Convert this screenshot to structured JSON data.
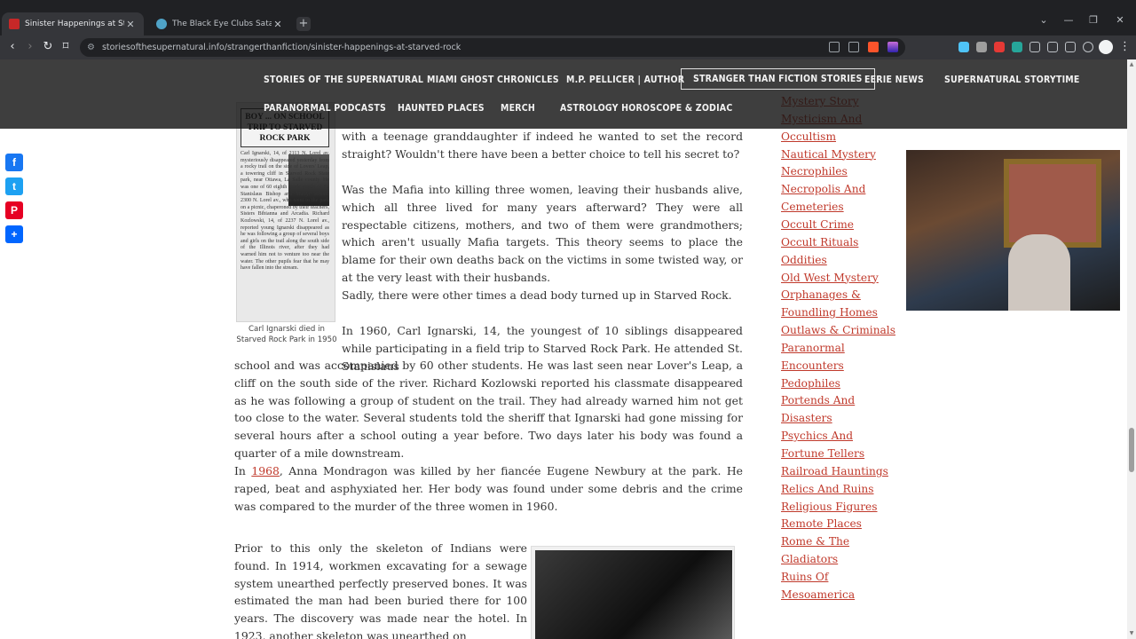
{
  "browser": {
    "tabs": [
      {
        "title": "Sinister Happenings at Starved R",
        "active": true,
        "favicon_color": "#c62828"
      },
      {
        "title": "The Black Eye Clubs Satanic Illuminat",
        "active": false,
        "favicon_color": "#4fa3c7"
      }
    ],
    "newtab_label": "+",
    "url": "storiesofthesupernatural.info/strangerthanfiction/sinister-happenings-at-starved-rock"
  },
  "nav": {
    "row1": [
      "STORIES OF THE SUPERNATURAL",
      "MIAMI GHOST CHRONICLES",
      "M.P. PELLICER | AUTHOR",
      "STRANGER THAN FICTION STORIES",
      "EERIE NEWS",
      "SUPERNATURAL STORYTIME"
    ],
    "row2": [
      "PARANORMAL PODCASTS",
      "HAUNTED PLACES",
      "MERCH",
      "ASTROLOGY HOROSCOPE & ZODIAC"
    ]
  },
  "share": [
    {
      "name": "Facebook",
      "glyph": "f",
      "color": "#1877f2"
    },
    {
      "name": "Twitter",
      "glyph": "t",
      "color": "#1da1f2"
    },
    {
      "name": "Pinterest",
      "glyph": "P",
      "color": "#e60023"
    },
    {
      "name": "Share",
      "glyph": "+",
      "color": "#0166ff"
    }
  ],
  "article": {
    "p_top": "with a teenage granddaughter if indeed he wanted to set the record straight? Wouldn't there have been a better choice to tell his secret to?",
    "p_mafia": "Was the Mafia into killing three women, leaving their husbands alive, which all three lived for many years afterward? They were all respectable citizens, mothers, and two of them were grandmothers; which aren't usually Mafia targets. This theory seems to place the blame for their own deaths back on the victims in some twisted way, or at the very least with their husbands.",
    "p_sadly": "Sadly, there were other times a dead body turned up in Starved Rock.",
    "p_1960_a": "In 1960, Carl Ignarski, 14, the youngest of 10 siblings disappeared while participating in a field trip to Starved Rock Park. He attended St. Stanislaus",
    "p_1960_b": "school and was accompanied by 60 other students. He was last seen near Lover's Leap, a cliff on the south side of the river. Richard Kozlowski reported his classmate disappeared as he was following a group of student on the trail. They had already warned him not get too close to the water. Several students told the sheriff that Ignarski had gone missing for several hours after a school outing a year before. Two days later his body was found a quarter of a mile downstream.",
    "p_1968_prefix": "In ",
    "p_1968_link": "1968",
    "p_1968_rest": ", Anna Mondragon was killed by her fiancée Eugene Newbury at the park. He raped, beat and asphyxiated her. Her body was found under some debris and the crime was compared to the murder of the three women in 1960.",
    "p_skeleton": "Prior to this only the skeleton of Indians were found.  In 1914, workmen excavating for a sewage system unearthed perfectly preserved bones. It was estimated the man had been buried there for 100 years. The discovery was made near the hotel. In 1923,  another skeleton was unearthed on",
    "figure_headline": "BOY ... ON SCHOOL TRIP TO STARVED ROCK PARK",
    "figure_text": "Carl Ignarski, 14, of 2113 N. Lorel av. mysteriously disappeared yesterday from a rocky trail on the side of Lovers' Leap, a towering cliff in Starved Rock State park, near Ottawa, La Salle county. He was one of 60 eighth grade pupils of St. Stanislaus Bishop and Martyr school, 2300 N. Lorel av., who went to the park on a picnic, chaperoned by their teachers, Sisters Bibianna and Arcadia. Richard Kozlowski, 14, of 2237 N. Lorel av., reported young Ignarski disappeared as he was following a group of several boys and girls on the trail along the south side of the Illinois river, after they had warned him not to venture too near the water. The other pupils fear that he may have fallen into the stream.",
    "figure_caption": "Carl Ignarski died in Starved Rock Park in 1950"
  },
  "categories": [
    "Mystery Story",
    "Mysticism And",
    "Occultism",
    "Nautical Mystery",
    "Necrophiles",
    "Necropolis And",
    "Cemeteries",
    "Occult Crime",
    "Occult Rituals",
    "Oddities",
    "Old West Mystery",
    "Orphanages &",
    "Foundling Homes",
    "Outlaws & Criminals",
    "Paranormal",
    "Encounters",
    "Pedophiles",
    "Portends And",
    "Disasters",
    "Psychics And",
    "Fortune Tellers",
    "Railroad Hauntings",
    "Relics And Ruins",
    "Religious Figures",
    "Remote Places",
    "Rome & The",
    "Gladiators",
    "Ruins Of",
    "Mesoamerica"
  ],
  "colors": {
    "link": "#c0392b",
    "nav_bg": "#141414",
    "chrome_bg": "#202124"
  }
}
